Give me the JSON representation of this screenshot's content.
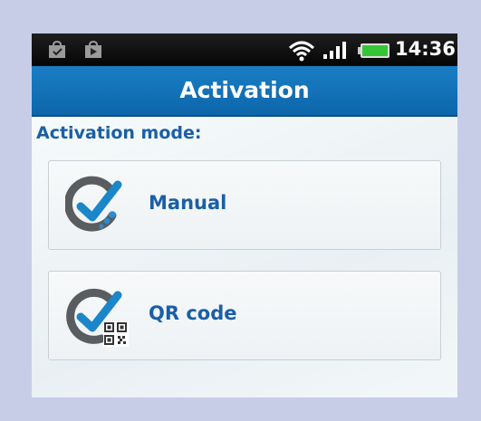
{
  "status_bar": {
    "time": "14:36",
    "icons": [
      "shopping-bag-icon",
      "shopping-bag-icon",
      "wifi-icon",
      "signal-icon",
      "battery-icon"
    ]
  },
  "header": {
    "title": "Activation"
  },
  "main": {
    "mode_label": "Activation mode:",
    "options": [
      {
        "label": "Manual",
        "icon": "manual-check-icon"
      },
      {
        "label": "QR code",
        "icon": "qr-check-icon"
      }
    ]
  },
  "colors": {
    "title_bar": "#1478c0",
    "accent_text": "#1a5fa5",
    "status_bar": "#0a0a0a",
    "battery": "#35c637"
  }
}
